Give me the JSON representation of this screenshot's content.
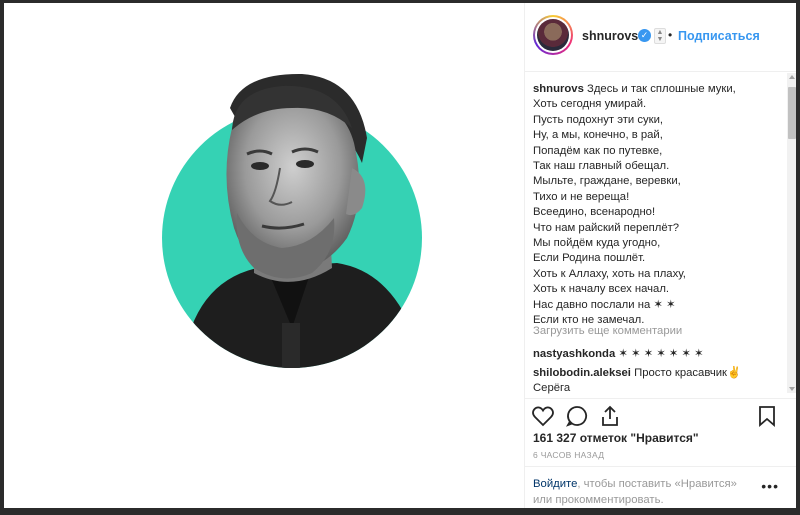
{
  "post": {
    "username": "shnurovs",
    "follow_label": "Подписаться",
    "dot": "•",
    "caption_lines": [
      "Здесь и так сплошные муки,",
      "Хоть сегодня умирай.",
      "Пусть подохнут эти суки,",
      "Ну, а мы, конечно, в рай,",
      "Попадём как по путевке,",
      "Так наш главный обещал.",
      "Мыльте, граждане, веревки,",
      "Тихо и не вереща!",
      "Всеедино, всенародно!",
      "Что нам райский переплёт?",
      "Мы пойдём куда угодно,",
      "Если Родина пошлёт.",
      "Хоть к Аллаху, хоть на плаху,",
      "Хоть к началу всех начал.",
      "Нас давно послали на ✶ ✶",
      "Если кто не замечал."
    ],
    "load_more": "Загрузить еще комментарии",
    "comments": [
      {
        "user": "nastyashkonda",
        "text": "✶ ✶ ✶ ✶ ✶ ✶ ✶"
      },
      {
        "user": "shilobodin.aleksei",
        "text": "Просто красавчик✌",
        "text2": "Серёга"
      }
    ],
    "likes": "161 327 отметок \"Нравится\"",
    "time": "6 ЧАСОВ НАЗАД",
    "login_link": "Войдите",
    "login_text": ", чтобы поставить «Нравится» или прокомментировать.",
    "more_icon": "•••"
  },
  "icons": {
    "verified": "verified-badge",
    "like": "heart-icon",
    "comment": "comment-icon",
    "share": "share-icon",
    "save": "bookmark-icon",
    "more": "more-options-icon"
  },
  "colors": {
    "accent": "#3897f0",
    "circle": "#35d2b4",
    "text": "#262626",
    "muted": "#999999"
  }
}
